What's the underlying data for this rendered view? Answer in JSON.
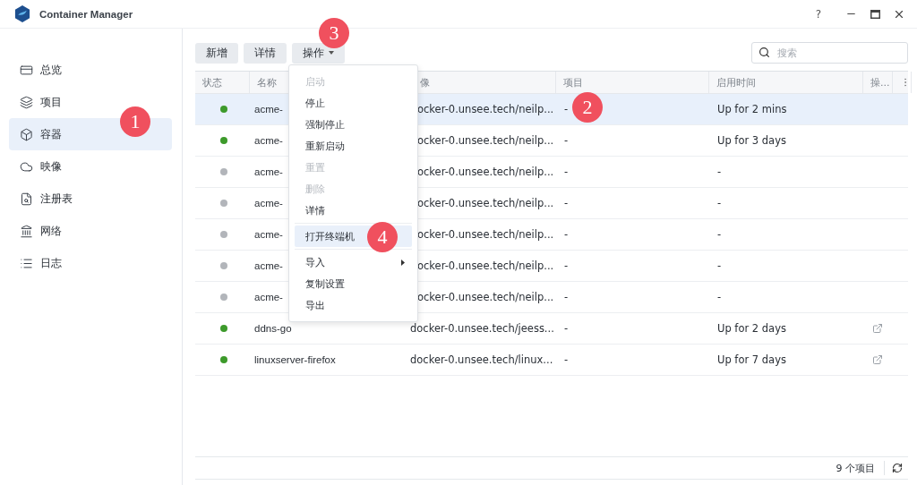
{
  "window": {
    "title": "Container Manager",
    "help": "?"
  },
  "sidebar": {
    "items": [
      {
        "label": "总览",
        "selected": false
      },
      {
        "label": "项目",
        "selected": false
      },
      {
        "label": "容器",
        "selected": true
      },
      {
        "label": "映像",
        "selected": false
      },
      {
        "label": "注册表",
        "selected": false
      },
      {
        "label": "网络",
        "selected": false
      },
      {
        "label": "日志",
        "selected": false
      }
    ]
  },
  "toolbar": {
    "buttons": [
      {
        "label": "新增",
        "dropdown": false
      },
      {
        "label": "详情",
        "dropdown": false
      },
      {
        "label": "操作",
        "dropdown": true
      }
    ],
    "search": {
      "placeholder": "搜索"
    }
  },
  "table": {
    "columns": [
      "状态",
      "名称",
      "像",
      "项目",
      "启用时间",
      "操..."
    ],
    "rows": [
      {
        "color": "#3d9a2b",
        "name": "acme-",
        "image": "ocker-0.unsee.tech/neilp...",
        "project": "-",
        "uptime": "Up for 2 mins",
        "link": false,
        "selected": true
      },
      {
        "color": "#3d9a2b",
        "name": "acme-",
        "image": "ocker-0.unsee.tech/neilp...",
        "project": "-",
        "uptime": "Up for 3 days",
        "link": false,
        "selected": false
      },
      {
        "color": "#b2b5ba",
        "name": "acme-",
        "image": "ocker-0.unsee.tech/neilp...",
        "project": "-",
        "uptime": "-",
        "link": false,
        "selected": false
      },
      {
        "color": "#b2b5ba",
        "name": "acme-",
        "image": "ocker-0.unsee.tech/neilp...",
        "project": "-",
        "uptime": "-",
        "link": false,
        "selected": false
      },
      {
        "color": "#b2b5ba",
        "name": "acme-",
        "image": "ocker-0.unsee.tech/neilp...",
        "project": "-",
        "uptime": "-",
        "link": false,
        "selected": false
      },
      {
        "color": "#b2b5ba",
        "name": "acme-",
        "image": "ocker-0.unsee.tech/neilp...",
        "project": "-",
        "uptime": "-",
        "link": false,
        "selected": false
      },
      {
        "color": "#b2b5ba",
        "name": "acme-",
        "image": "ocker-0.unsee.tech/neilp...",
        "project": "-",
        "uptime": "-",
        "link": false,
        "selected": false
      },
      {
        "color": "#3d9a2b",
        "name": "ddns-go",
        "image": "docker-0.unsee.tech/jeess...",
        "project": "-",
        "uptime": "Up for 2 days",
        "link": true,
        "selected": false
      },
      {
        "color": "#3d9a2b",
        "name": "linuxserver-firefox",
        "image": "docker-0.unsee.tech/linux...",
        "project": "-",
        "uptime": "Up for 7 days",
        "link": true,
        "selected": false
      }
    ],
    "footer": "9 个项目"
  },
  "menu": {
    "items": [
      {
        "kind": "item",
        "label": "启动",
        "disabled": true,
        "selected": false,
        "submenu": false
      },
      {
        "kind": "item",
        "label": "停止",
        "disabled": false,
        "selected": false,
        "submenu": false
      },
      {
        "kind": "item",
        "label": "强制停止",
        "disabled": false,
        "selected": false,
        "submenu": false
      },
      {
        "kind": "item",
        "label": "重新启动",
        "disabled": false,
        "selected": false,
        "submenu": false
      },
      {
        "kind": "item",
        "label": "重置",
        "disabled": true,
        "selected": false,
        "submenu": false
      },
      {
        "kind": "item",
        "label": "删除",
        "disabled": true,
        "selected": false,
        "submenu": false
      },
      {
        "kind": "item",
        "label": "详情",
        "disabled": false,
        "selected": false,
        "submenu": false
      },
      {
        "kind": "separator"
      },
      {
        "kind": "item",
        "label": "打开终端机",
        "disabled": false,
        "selected": true,
        "submenu": false
      },
      {
        "kind": "separator"
      },
      {
        "kind": "item",
        "label": "导入",
        "disabled": false,
        "selected": false,
        "submenu": true
      },
      {
        "kind": "item",
        "label": "复制设置",
        "disabled": false,
        "selected": false,
        "submenu": false
      },
      {
        "kind": "item",
        "label": "导出",
        "disabled": false,
        "selected": false,
        "submenu": false
      }
    ]
  },
  "annotations": [
    "1",
    "2",
    "3",
    "4"
  ]
}
